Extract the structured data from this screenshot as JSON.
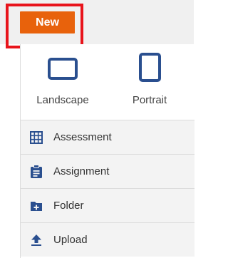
{
  "toolbar": {
    "new_label": "New"
  },
  "orientation": {
    "landscape_label": "Landscape",
    "portrait_label": "Portrait"
  },
  "menu": {
    "items": [
      {
        "label": "Assessment",
        "icon": "grid-icon"
      },
      {
        "label": "Assignment",
        "icon": "clipboard-icon"
      },
      {
        "label": "Folder",
        "icon": "folder-add-icon"
      },
      {
        "label": "Upload",
        "icon": "upload-icon"
      }
    ]
  },
  "colors": {
    "accent": "#e8620c",
    "highlight": "#e8141b",
    "icon_blue": "#2a4f8f"
  }
}
